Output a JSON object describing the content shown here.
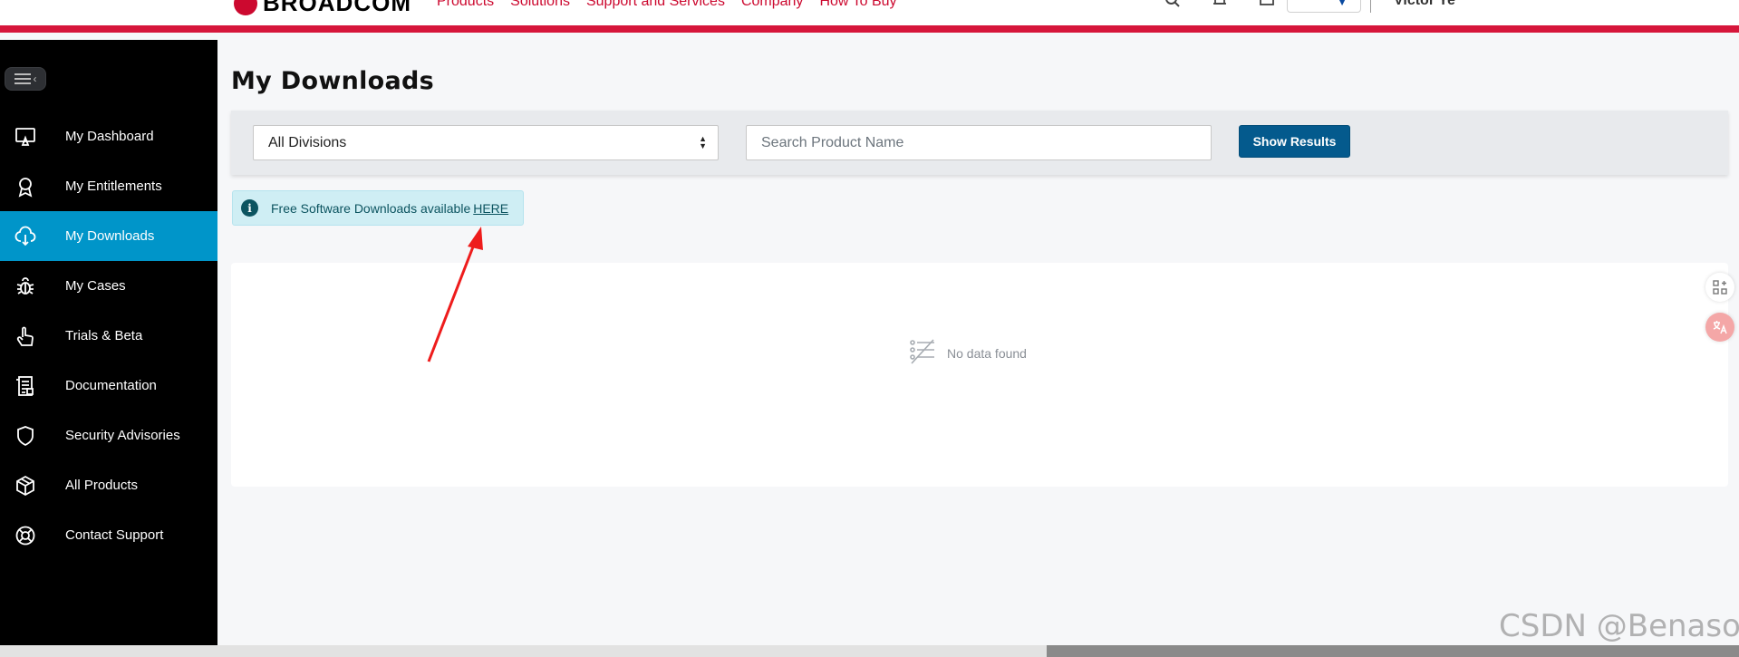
{
  "header": {
    "logo_text": "BROADCOM",
    "nav": [
      "Products",
      "Solutions",
      "Support and Services",
      "Company",
      "How To Buy"
    ],
    "user_name": "Victor Ye",
    "icons": [
      "search-icon",
      "bell-icon",
      "cart-icon"
    ]
  },
  "sidebar": {
    "collapse_icon": "menu-collapse-icon",
    "items": [
      {
        "label": "My Dashboard",
        "icon": "dashboard-icon",
        "active": false
      },
      {
        "label": "My Entitlements",
        "icon": "award-icon",
        "active": false
      },
      {
        "label": "My Downloads",
        "icon": "cloud-download-icon",
        "active": true
      },
      {
        "label": "My Cases",
        "icon": "bug-icon",
        "active": false
      },
      {
        "label": "Trials & Beta",
        "icon": "pointer-hand-icon",
        "active": false
      },
      {
        "label": "Documentation",
        "icon": "document-icon",
        "active": false
      },
      {
        "label": "Security Advisories",
        "icon": "shield-icon",
        "active": false
      },
      {
        "label": "All Products",
        "icon": "box-icon",
        "active": false
      },
      {
        "label": "Contact Support",
        "icon": "lifebuoy-icon",
        "active": false
      }
    ]
  },
  "main": {
    "title": "My Downloads",
    "filters": {
      "division_selected": "All Divisions",
      "search_placeholder": "Search Product Name",
      "show_results_label": "Show Results"
    },
    "alert": {
      "text": "Free Software Downloads available",
      "link_text": "HERE"
    },
    "results": {
      "empty_text": "No data found"
    }
  },
  "watermark": "CSDN @Benaso",
  "colors": {
    "brand_red": "#d6163b",
    "sidebar_bg": "#000000",
    "active_item": "#0095c9",
    "primary_button": "#045a8d",
    "alert_bg": "#cfeef4",
    "annotation_arrow": "#ee1c1c"
  }
}
